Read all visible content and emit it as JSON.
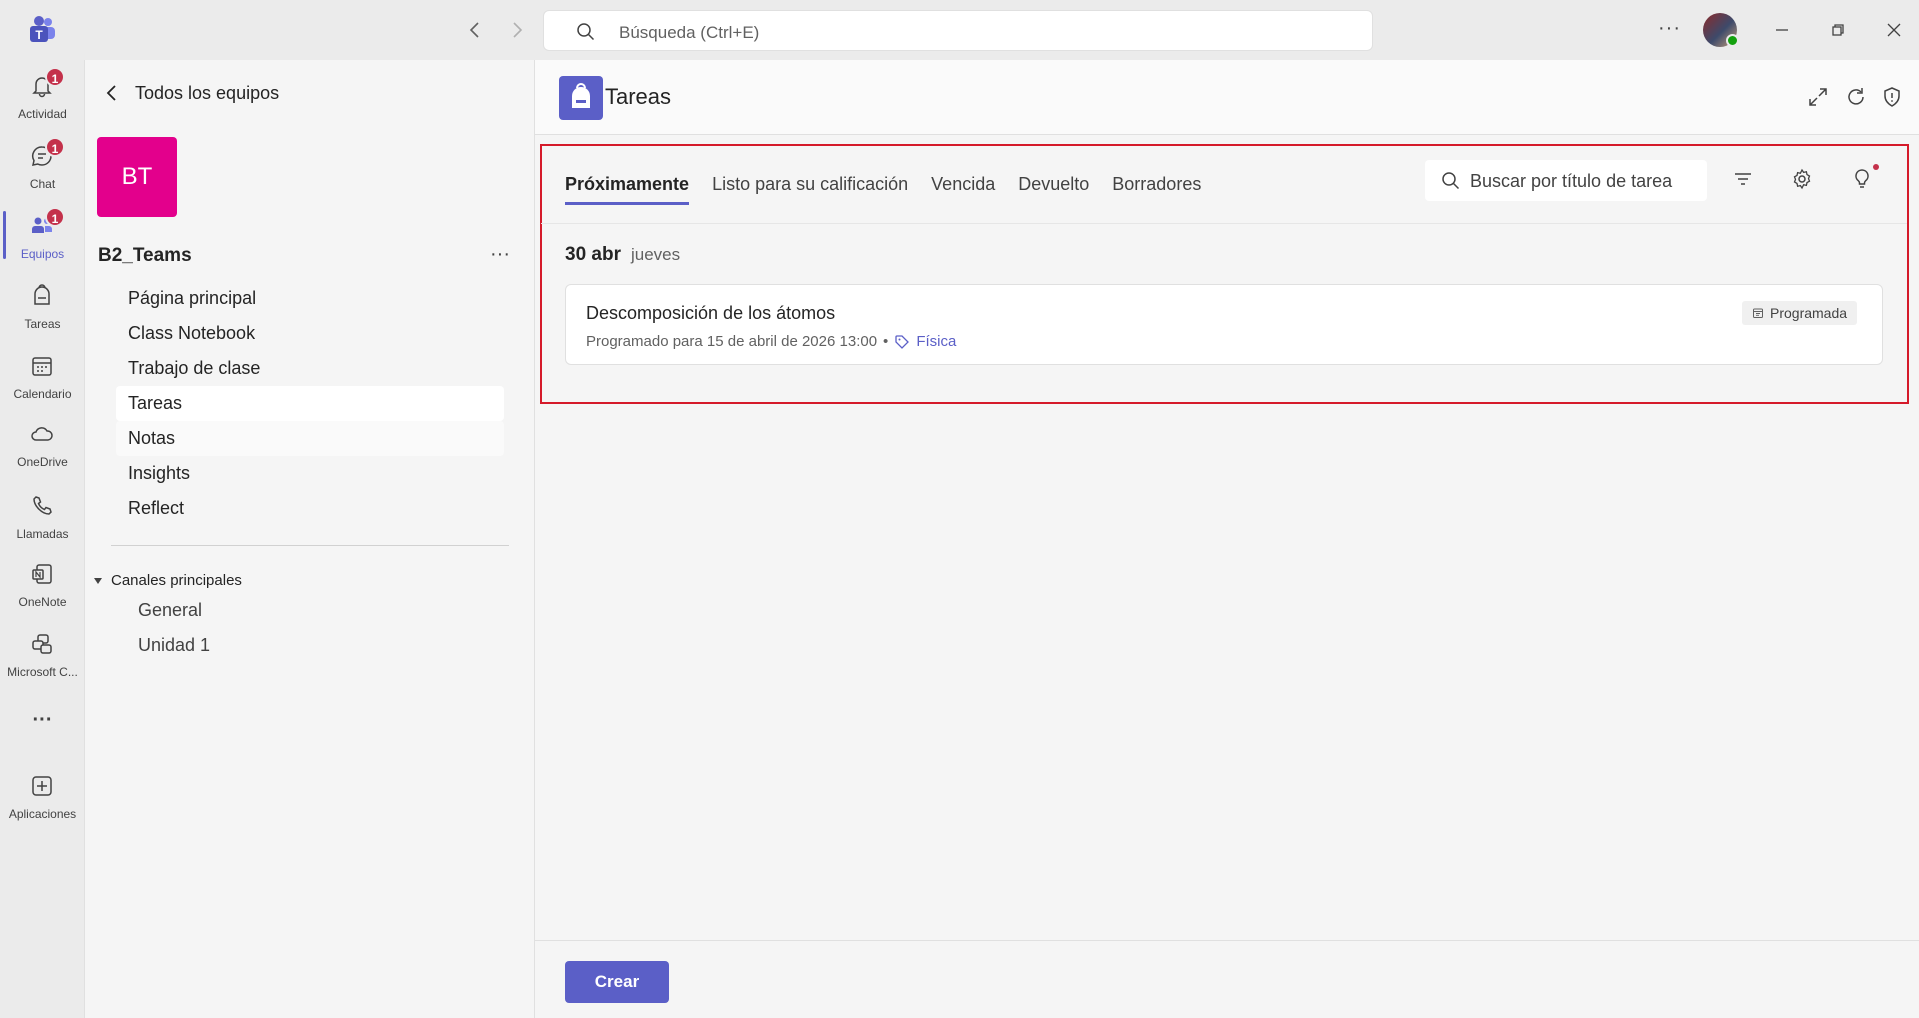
{
  "titlebar": {
    "search_placeholder": "Búsqueda (Ctrl+E)",
    "more_label": "···"
  },
  "rail": {
    "items": [
      {
        "label": "Actividad",
        "badge": "1",
        "icon": "bell-icon"
      },
      {
        "label": "Chat",
        "badge": "1",
        "icon": "chat-icon"
      },
      {
        "label": "Equipos",
        "badge": "1",
        "icon": "teams-icon"
      },
      {
        "label": "Tareas",
        "icon": "backpack-icon"
      },
      {
        "label": "Calendario",
        "icon": "calendar-icon"
      },
      {
        "label": "OneDrive",
        "icon": "cloud-icon"
      },
      {
        "label": "Llamadas",
        "icon": "phone-icon"
      },
      {
        "label": "OneNote",
        "icon": "onenote-icon"
      },
      {
        "label": "Microsoft C...",
        "icon": "copilot-icon"
      },
      {
        "label": "···",
        "icon": "more-icon"
      },
      {
        "label": "Aplicaciones",
        "icon": "apps-add-icon"
      }
    ]
  },
  "team": {
    "back_label": "Todos los equipos",
    "initials": "BT",
    "name": "B2_Teams",
    "more": "···",
    "nav": [
      "Página principal",
      "Class Notebook",
      "Trabajo de clase",
      "Tareas",
      "Notas",
      "Insights",
      "Reflect"
    ],
    "channels_header": "Canales principales",
    "channels": [
      "General",
      "Unidad 1"
    ]
  },
  "app": {
    "title": "Tareas",
    "tabs": [
      "Próximamente",
      "Listo para su calificación",
      "Vencida",
      "Devuelto",
      "Borradores"
    ],
    "search_placeholder": "Buscar por título de tarea",
    "date": "30 abr",
    "weekday": "jueves",
    "assignment": {
      "title": "Descomposición de los átomos",
      "meta": "Programado para 15 de abril de 2026 13:00",
      "bullet": "•",
      "tag": "Física",
      "status": "Programada"
    },
    "create_label": "Crear"
  },
  "colors": {
    "accent": "#5b5fc7",
    "team_avatar": "#e3008c",
    "badge": "#c4314b",
    "highlight_frame": "#d51a2a"
  }
}
